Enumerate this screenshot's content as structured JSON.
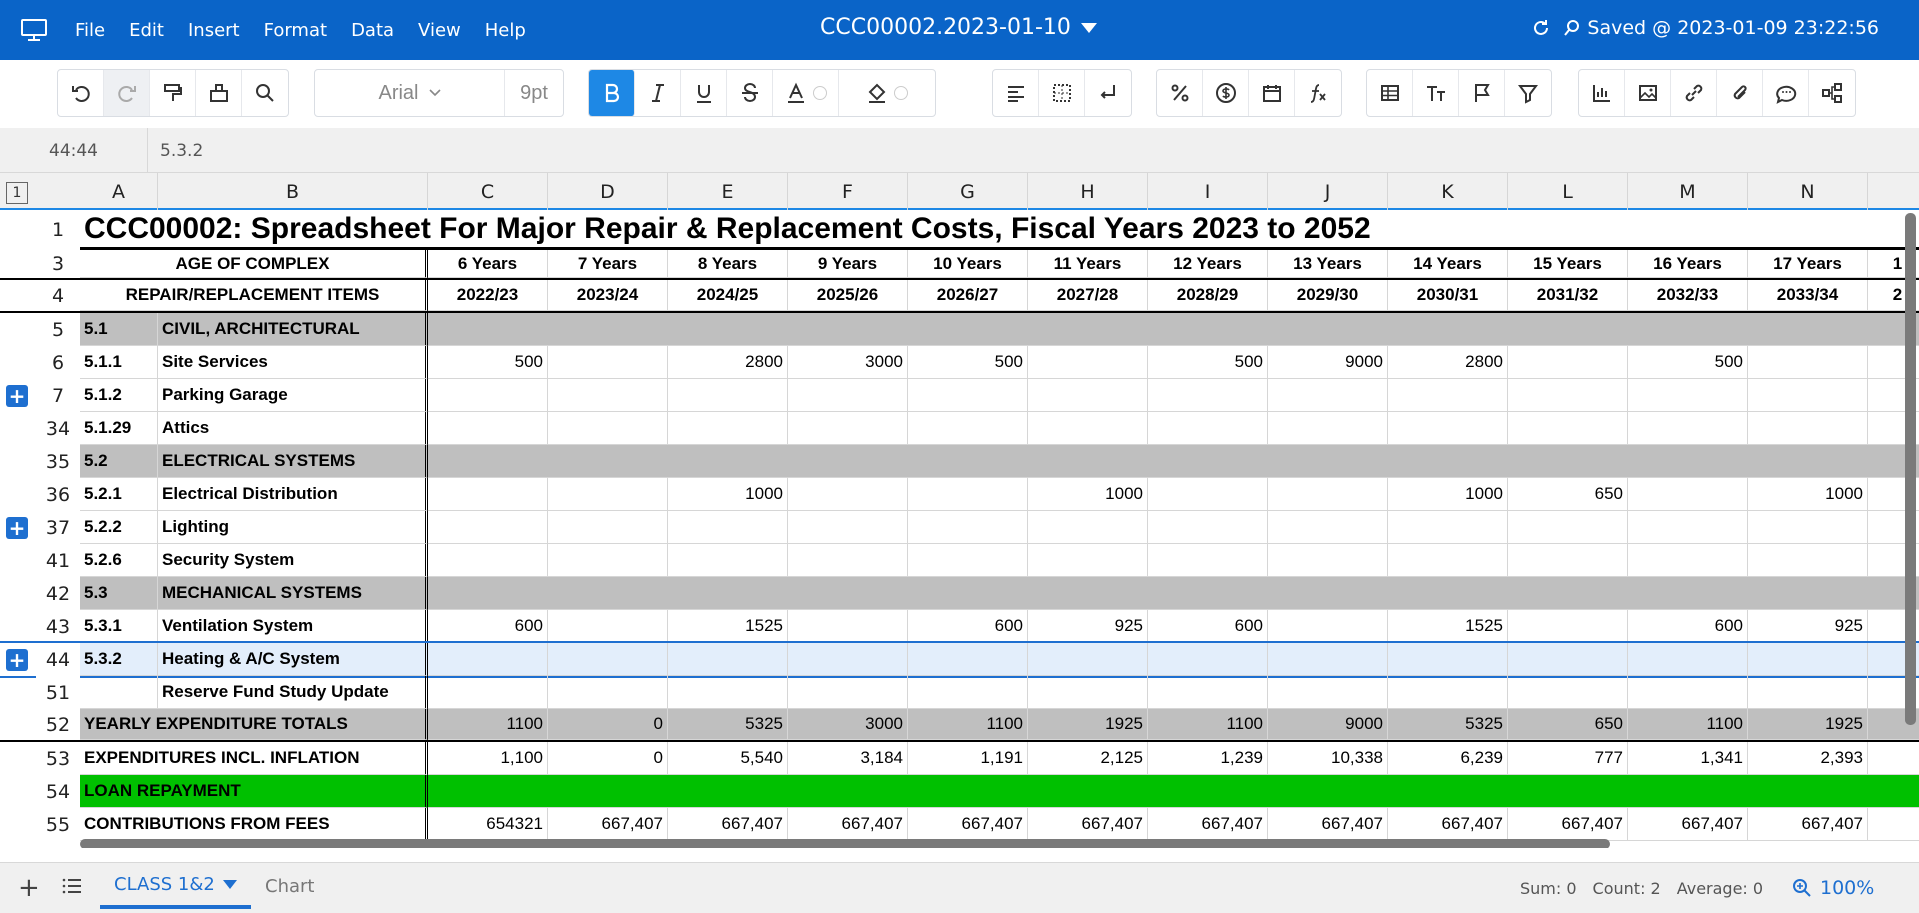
{
  "menus": [
    "File",
    "Edit",
    "Insert",
    "Format",
    "Data",
    "View",
    "Help"
  ],
  "doc_title": "CCC00002.2023-01-10",
  "saved_status": "Saved @ 2023-01-09 23:22:56",
  "toolbar": {
    "font": "Arial",
    "font_size": "9pt"
  },
  "formula_bar": {
    "cell_ref": "44:44",
    "value": "5.3.2"
  },
  "corner_label": "1",
  "columns": [
    "A",
    "B",
    "C",
    "D",
    "E",
    "F",
    "G",
    "H",
    "I",
    "J",
    "K",
    "L",
    "M",
    "N"
  ],
  "rows": [
    {
      "num": "1",
      "kind": "title",
      "text": "CCC00002: Spreadsheet For Major Repair & Replacement Costs, Fiscal Years 2023 to 2052"
    },
    {
      "num": "3",
      "kind": "header",
      "label": "AGE OF COMPLEX",
      "vals": [
        "6 Years",
        "7 Years",
        "8 Years",
        "9 Years",
        "10 Years",
        "11 Years",
        "12 Years",
        "13 Years",
        "14 Years",
        "15 Years",
        "16 Years",
        "17 Years",
        "1"
      ]
    },
    {
      "num": "4",
      "kind": "header",
      "label": "REPAIR/REPLACEMENT ITEMS",
      "vals": [
        "2022/23",
        "2023/24",
        "2024/25",
        "2025/26",
        "2026/27",
        "2027/28",
        "2028/29",
        "2029/30",
        "2030/31",
        "2031/32",
        "2032/33",
        "2033/34",
        "2"
      ]
    },
    {
      "num": "5",
      "kind": "section",
      "a": "5.1",
      "b": "CIVIL, ARCHITECTURAL"
    },
    {
      "num": "6",
      "kind": "item",
      "a": "5.1.1",
      "b": "Site Services",
      "vals": [
        "500",
        "",
        "2800",
        "3000",
        "500",
        "",
        "500",
        "9000",
        "2800",
        "",
        "500",
        "",
        ""
      ]
    },
    {
      "num": "7",
      "kind": "item",
      "plus": true,
      "a": "5.1.2",
      "b": "Parking Garage",
      "vals": [
        "",
        "",
        "",
        "",
        "",
        "",
        "",
        "",
        "",
        "",
        "",
        "",
        ""
      ]
    },
    {
      "num": "34",
      "kind": "item",
      "a": "5.1.29",
      "b": "Attics",
      "vals": [
        "",
        "",
        "",
        "",
        "",
        "",
        "",
        "",
        "",
        "",
        "",
        "",
        ""
      ]
    },
    {
      "num": "35",
      "kind": "section",
      "a": "5.2",
      "b": "ELECTRICAL SYSTEMS"
    },
    {
      "num": "36",
      "kind": "item",
      "a": "5.2.1",
      "b": "Electrical Distribution",
      "vals": [
        "",
        "",
        "1000",
        "",
        "",
        "1000",
        "",
        "",
        "1000",
        "650",
        "",
        "1000",
        ""
      ]
    },
    {
      "num": "37",
      "kind": "item",
      "plus": true,
      "a": "5.2.2",
      "b": "Lighting",
      "vals": [
        "",
        "",
        "",
        "",
        "",
        "",
        "",
        "",
        "",
        "",
        "",
        "",
        ""
      ]
    },
    {
      "num": "41",
      "kind": "item",
      "a": "5.2.6",
      "b": "Security System",
      "vals": [
        "",
        "",
        "",
        "",
        "",
        "",
        "",
        "",
        "",
        "",
        "",
        "",
        ""
      ]
    },
    {
      "num": "42",
      "kind": "section",
      "a": "5.3",
      "b": "MECHANICAL SYSTEMS"
    },
    {
      "num": "43",
      "kind": "item",
      "a": "5.3.1",
      "b": "Ventilation System",
      "vals": [
        "600",
        "",
        "1525",
        "",
        "600",
        "925",
        "600",
        "",
        "1525",
        "",
        "600",
        "925",
        ""
      ]
    },
    {
      "num": "44",
      "kind": "item",
      "plus": true,
      "selected": true,
      "a": "5.3.2",
      "b": "Heating & A/C System",
      "vals": [
        "",
        "",
        "",
        "",
        "",
        "",
        "",
        "",
        "",
        "",
        "",
        "",
        ""
      ]
    },
    {
      "num": "51",
      "kind": "item",
      "a": "",
      "b": "Reserve Fund Study Update",
      "vals": [
        "",
        "",
        "",
        "",
        "",
        "",
        "",
        "",
        "",
        "",
        "",
        "",
        ""
      ]
    },
    {
      "num": "52",
      "kind": "total",
      "label": "YEARLY EXPENDITURE TOTALS",
      "vals": [
        "1100",
        "0",
        "5325",
        "3000",
        "1100",
        "1925",
        "1100",
        "9000",
        "5325",
        "650",
        "1100",
        "1925",
        ""
      ]
    },
    {
      "num": "53",
      "kind": "plain",
      "label": "EXPENDITURES INCL. INFLATION",
      "vals": [
        "1,100",
        "0",
        "5,540",
        "3,184",
        "1,191",
        "2,125",
        "1,239",
        "10,338",
        "6,239",
        "777",
        "1,341",
        "2,393",
        ""
      ]
    },
    {
      "num": "54",
      "kind": "green",
      "label": "LOAN REPAYMENT"
    },
    {
      "num": "55",
      "kind": "plain",
      "label": "CONTRIBUTIONS FROM FEES",
      "vals": [
        "654321",
        "667,407",
        "667,407",
        "667,407",
        "667,407",
        "667,407",
        "667,407",
        "667,407",
        "667,407",
        "667,407",
        "667,407",
        "667,407",
        ""
      ]
    }
  ],
  "sheet_tabs": [
    "CLASS 1&2",
    "Chart"
  ],
  "status": {
    "sum": "Sum: 0",
    "count": "Count: 2",
    "average": "Average: 0",
    "zoom": "100%"
  }
}
